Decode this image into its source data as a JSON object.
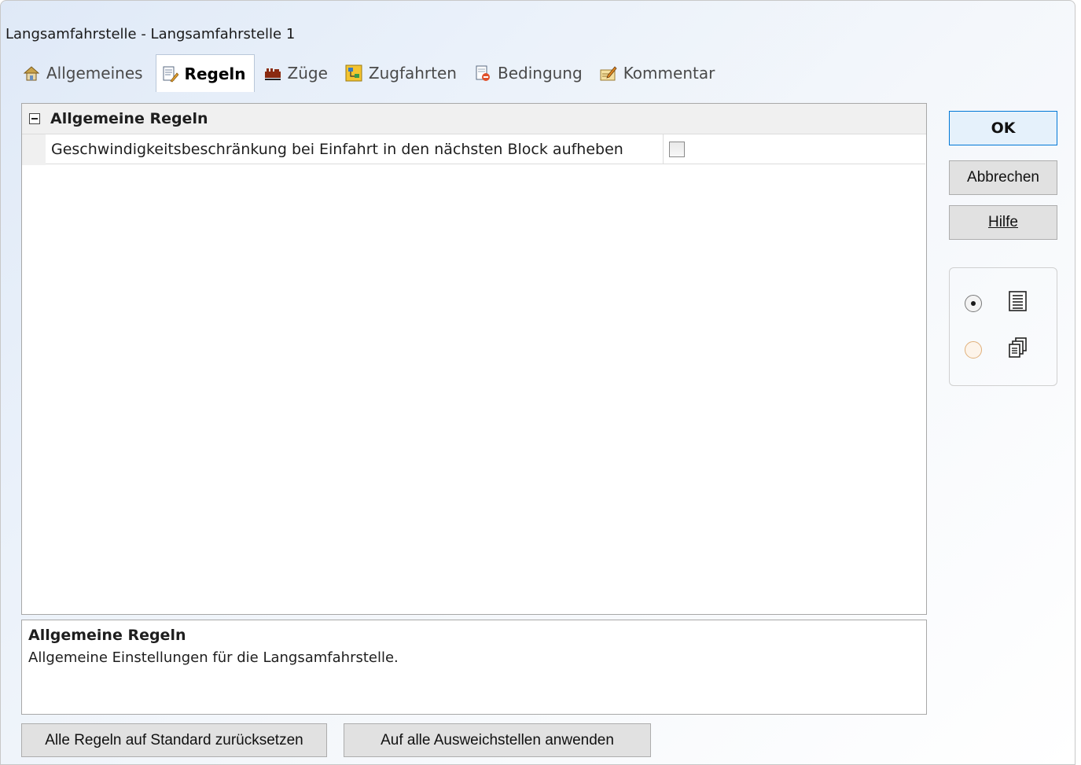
{
  "window": {
    "title": "Langsamfahrstelle - Langsamfahrstelle 1"
  },
  "tabs": [
    {
      "label": "Allgemeines",
      "icon": "house-settings-icon",
      "active": false
    },
    {
      "label": "Regeln",
      "icon": "rules-document-icon",
      "active": true
    },
    {
      "label": "Züge",
      "icon": "train-icon",
      "active": false
    },
    {
      "label": "Zugfahrten",
      "icon": "routes-icon",
      "active": false
    },
    {
      "label": "Bedingung",
      "icon": "condition-document-icon",
      "active": false
    },
    {
      "label": "Kommentar",
      "icon": "comment-pencil-icon",
      "active": false
    }
  ],
  "property_grid": {
    "category": {
      "label": "Allgemeine Regeln",
      "expanded": true
    },
    "properties": [
      {
        "name": "Geschwindigkeitsbeschränkung bei Einfahrt in den nächsten Block aufheben",
        "checked": false
      }
    ]
  },
  "description": {
    "title": "Allgemeine Regeln",
    "text": "Allgemeine Einstellungen für die Langsamfahrstelle."
  },
  "buttons": {
    "ok": "OK",
    "cancel": "Abbrechen",
    "help": "Hilfe",
    "reset_rules": "Alle Regeln auf Standard zurücksetzen",
    "apply_all": "Auf alle Ausweichstellen anwenden"
  },
  "view_mode": {
    "options": [
      {
        "icon": "list-view-icon",
        "selected": true
      },
      {
        "icon": "pages-view-icon",
        "selected": false
      }
    ]
  },
  "colors": {
    "ok_accent": "#0078d7",
    "active_tab_bg": "#ffffff",
    "window_gradient_start": "#dfe9f7"
  }
}
